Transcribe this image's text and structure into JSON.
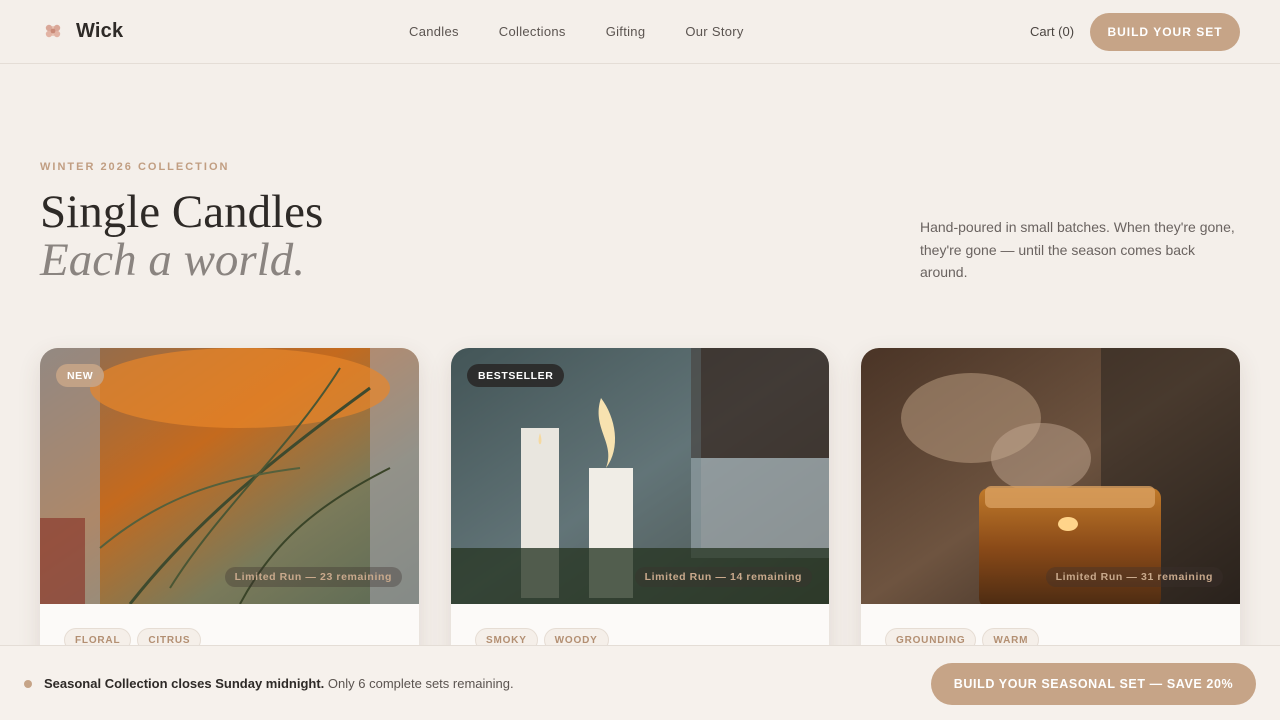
{
  "nav": {
    "brand": "Wick",
    "links": [
      "Candles",
      "Collections",
      "Gifting",
      "Our Story"
    ],
    "cart": "Cart (0)",
    "cta": "BUILD YOUR SET"
  },
  "hero": {
    "eyebrow": "WINTER 2026 COLLECTION",
    "title": "Single Candles",
    "subtitle": "Each a world.",
    "intro": "Hand-poured in small batches. When they're gone, they're gone — until the season comes back around."
  },
  "products": [
    {
      "badge": "NEW",
      "limited": "Limited Run — 23 remaining",
      "tags": [
        "FLORAL",
        "CITRUS"
      ]
    },
    {
      "badge": "BESTSELLER",
      "limited": "Limited Run — 14 remaining",
      "tags": [
        "SMOKY",
        "WOODY"
      ]
    },
    {
      "badge": "",
      "limited": "Limited Run — 31 remaining",
      "tags": [
        "GROUNDING",
        "WARM"
      ]
    }
  ],
  "sticky": {
    "bold": "Seasonal Collection closes Sunday midnight.",
    "rest": "Only 6 complete sets remaining.",
    "cta": "BUILD YOUR SEASONAL SET — SAVE 20%"
  },
  "colors": {
    "accent": "#c6a487",
    "background": "#f4efea",
    "text": "#2e2a27"
  },
  "icons": {
    "brand": "candle-logo-icon"
  }
}
